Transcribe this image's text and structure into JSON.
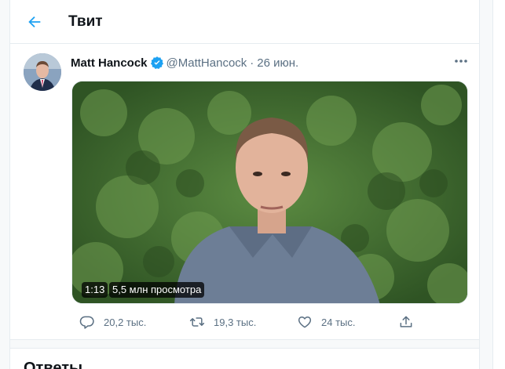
{
  "header": {
    "title": "Твит",
    "back_icon": "arrow-left-icon"
  },
  "tweet": {
    "author_name": "Matt Hancock",
    "verified": true,
    "handle": "@MattHancock",
    "separator": "·",
    "date": "26 июн.",
    "more_icon": "more-horizontal-icon",
    "media": {
      "duration": "1:13",
      "views": "5,5 млн просмотра"
    },
    "actions": {
      "replies": "20,2 тыс.",
      "retweets": "19,3 тыс.",
      "likes": "24 тыс.",
      "share_icon": "share-icon"
    }
  },
  "replies_section": {
    "title": "Ответы"
  },
  "colors": {
    "accent": "#1da1f2",
    "muted_text": "#5b7083",
    "border": "#e6ecf0"
  }
}
